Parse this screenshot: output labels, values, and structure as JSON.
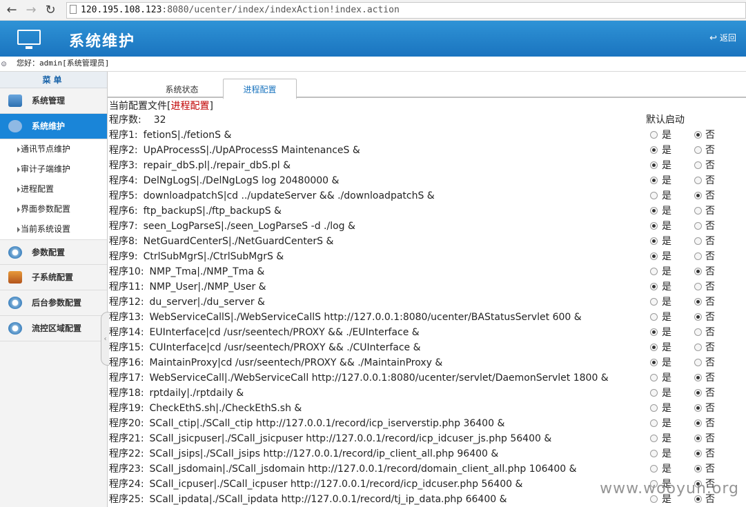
{
  "browser": {
    "host": "120.195.108.123",
    "path": ":8080/ucenter/index/indexAction!index.action"
  },
  "header": {
    "title": "系统维护",
    "back": "返回"
  },
  "welcome": "您好：admin[系统管理员]",
  "sidebar": {
    "menu_title": "菜单",
    "top_items": [
      {
        "label": "系统管理"
      },
      {
        "label": "系统维护"
      }
    ],
    "sub_items": [
      {
        "label": "通讯节点维护"
      },
      {
        "label": "审计子端维护"
      },
      {
        "label": "进程配置"
      },
      {
        "label": "界面参数配置"
      },
      {
        "label": "当前系统设置"
      }
    ],
    "bottom_items": [
      {
        "label": "参数配置"
      },
      {
        "label": "子系统配置"
      },
      {
        "label": "后台参数配置"
      },
      {
        "label": "流控区域配置"
      }
    ]
  },
  "tabs": [
    {
      "label": "系统状态"
    },
    {
      "label": "进程配置"
    }
  ],
  "content": {
    "config_prefix": "当前配置文件[",
    "config_name": "进程配置",
    "config_suffix": "]",
    "count_label": "程序数:",
    "count_value": "32",
    "default_label": "默认启动",
    "yes": "是",
    "no": "否",
    "programs": [
      {
        "label": "程序1:",
        "cmd": "fetionS|./fetionS &",
        "default": "no"
      },
      {
        "label": "程序2:",
        "cmd": "UpAProcessS|./UpAProcessS MaintenanceS &",
        "default": "yes"
      },
      {
        "label": "程序3:",
        "cmd": "repair_dbS.pl|./repair_dbS.pl &",
        "default": "yes"
      },
      {
        "label": "程序4:",
        "cmd": "DelNgLogS|./DelNgLogS log 20480000 &",
        "default": "yes"
      },
      {
        "label": "程序5:",
        "cmd": "downloadpatchS|cd ../updateServer && ./downloadpatchS &",
        "default": "no"
      },
      {
        "label": "程序6:",
        "cmd": "ftp_backupS|./ftp_backupS &",
        "default": "yes"
      },
      {
        "label": "程序7:",
        "cmd": "seen_LogParseS|./seen_LogParseS -d ./log &",
        "default": "yes"
      },
      {
        "label": "程序8:",
        "cmd": "NetGuardCenterS|./NetGuardCenterS &",
        "default": "yes"
      },
      {
        "label": "程序9:",
        "cmd": "CtrlSubMgrS|./CtrlSubMgrS &",
        "default": "yes"
      },
      {
        "label": "程序10:",
        "cmd": "NMP_Tma|./NMP_Tma &",
        "default": "no"
      },
      {
        "label": "程序11:",
        "cmd": "NMP_User|./NMP_User &",
        "default": "yes"
      },
      {
        "label": "程序12:",
        "cmd": "du_server|./du_server &",
        "default": "no"
      },
      {
        "label": "程序13:",
        "cmd": "WebServiceCallS|./WebServiceCallS http://127.0.0.1:8080/ucenter/BAStatusServlet 600 &",
        "default": "no"
      },
      {
        "label": "程序14:",
        "cmd": "EUInterface|cd /usr/seentech/PROXY && ./EUInterface &",
        "default": "yes"
      },
      {
        "label": "程序15:",
        "cmd": "CUInterface|cd /usr/seentech/PROXY && ./CUInterface &",
        "default": "yes"
      },
      {
        "label": "程序16:",
        "cmd": "MaintainProxy|cd /usr/seentech/PROXY && ./MaintainProxy &",
        "default": "yes"
      },
      {
        "label": "程序17:",
        "cmd": "WebServiceCall|./WebServiceCall http://127.0.0.1:8080/ucenter/servlet/DaemonServlet 1800 &",
        "default": "no"
      },
      {
        "label": "程序18:",
        "cmd": "rptdaily|./rptdaily &",
        "default": "no"
      },
      {
        "label": "程序19:",
        "cmd": "CheckEthS.sh|./CheckEthS.sh &",
        "default": "no"
      },
      {
        "label": "程序20:",
        "cmd": "SCall_ctip|./SCall_ctip http://127.0.0.1/record/icp_iserverstip.php 36400 &",
        "default": "no"
      },
      {
        "label": "程序21:",
        "cmd": "SCall_jsicpuser|./SCall_jsicpuser http://127.0.0.1/record/icp_idcuser_js.php 56400 &",
        "default": "no"
      },
      {
        "label": "程序22:",
        "cmd": "SCall_jsips|./SCall_jsips http://127.0.0.1/record/ip_client_all.php 96400 &",
        "default": "no"
      },
      {
        "label": "程序23:",
        "cmd": "SCall_jsdomain|./SCall_jsdomain http://127.0.0.1/record/domain_client_all.php 106400 &",
        "default": "no"
      },
      {
        "label": "程序24:",
        "cmd": "SCall_icpuser|./SCall_icpuser http://127.0.0.1/record/icp_idcuser.php 56400 &",
        "default": "no"
      },
      {
        "label": "程序25:",
        "cmd": "SCall_ipdata|./SCall_ipdata http://127.0.0.1/record/tj_ip_data.php 66400 &",
        "default": "no"
      }
    ]
  },
  "watermark": "www.wooyun.org"
}
